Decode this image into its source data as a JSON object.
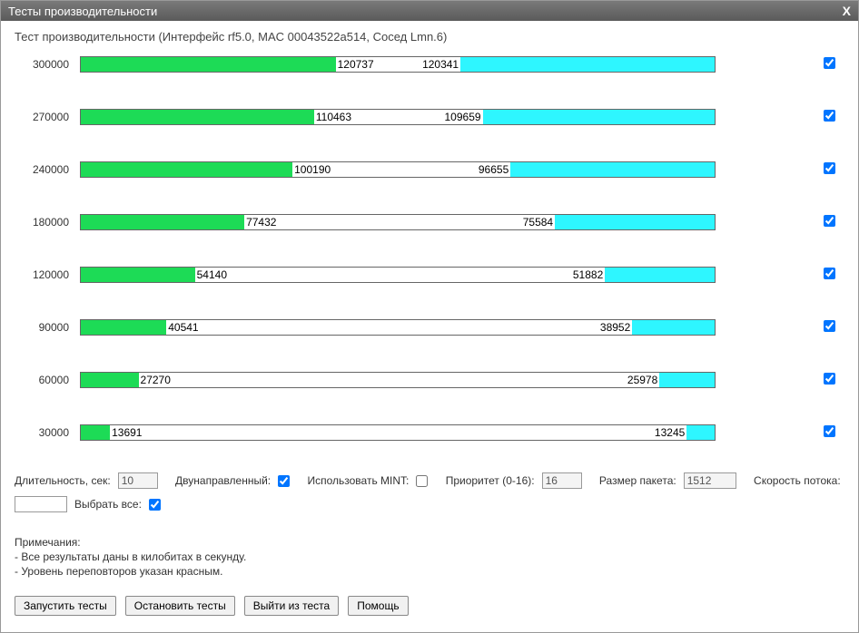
{
  "title": "Тесты производительности",
  "close_label": "X",
  "subtitle": "Тест производительности (Интерфейс rf5.0, MAC 00043522a514, Сосед Lmn.6)",
  "rows": [
    {
      "label": "300000",
      "green_pct": 40.2,
      "cyan_start_pct": 59.9,
      "cyan_pct": 40.1,
      "green_val": "120737",
      "cyan_val": "120341",
      "checked": true
    },
    {
      "label": "270000",
      "green_pct": 36.8,
      "cyan_start_pct": 63.4,
      "cyan_pct": 36.6,
      "green_val": "110463",
      "cyan_val": "109659",
      "checked": true
    },
    {
      "label": "240000",
      "green_pct": 33.4,
      "cyan_start_pct": 67.8,
      "cyan_pct": 32.2,
      "green_val": "100190",
      "cyan_val": "96655",
      "checked": true
    },
    {
      "label": "180000",
      "green_pct": 25.8,
      "cyan_start_pct": 74.8,
      "cyan_pct": 25.2,
      "green_val": "77432",
      "cyan_val": "75584",
      "checked": true
    },
    {
      "label": "120000",
      "green_pct": 18.0,
      "cyan_start_pct": 82.7,
      "cyan_pct": 17.3,
      "green_val": "54140",
      "cyan_val": "51882",
      "checked": true
    },
    {
      "label": "90000",
      "green_pct": 13.5,
      "cyan_start_pct": 87.0,
      "cyan_pct": 13.0,
      "green_val": "40541",
      "cyan_val": "38952",
      "checked": true
    },
    {
      "label": "60000",
      "green_pct": 9.1,
      "cyan_start_pct": 91.3,
      "cyan_pct": 8.7,
      "green_val": "27270",
      "cyan_val": "25978",
      "checked": true
    },
    {
      "label": "30000",
      "green_pct": 4.6,
      "cyan_start_pct": 95.6,
      "cyan_pct": 4.4,
      "green_val": "13691",
      "cyan_val": "13245",
      "checked": true
    }
  ],
  "controls": {
    "duration_label": "Длительность, сек:",
    "duration_val": "10",
    "bidir_label": "Двунаправленный:",
    "bidir_checked": true,
    "mint_label": "Использовать MINT:",
    "mint_checked": false,
    "priority_label": "Приоритет (0-16):",
    "priority_val": "16",
    "packet_label": "Размер пакета:",
    "packet_val": "1512",
    "rate_label": "Скорость потока:",
    "rate_val": "",
    "select_all_label": "Выбрать все:",
    "select_all_checked": true
  },
  "notes": {
    "heading": "Примечания:",
    "line1": "- Все результаты даны в килобитах в секунду.",
    "line2": "- Уровень переповторов указан красным."
  },
  "buttons": {
    "run": "Запустить тесты",
    "stop": "Остановить тесты",
    "exit": "Выйти из теста",
    "help": "Помощь"
  }
}
